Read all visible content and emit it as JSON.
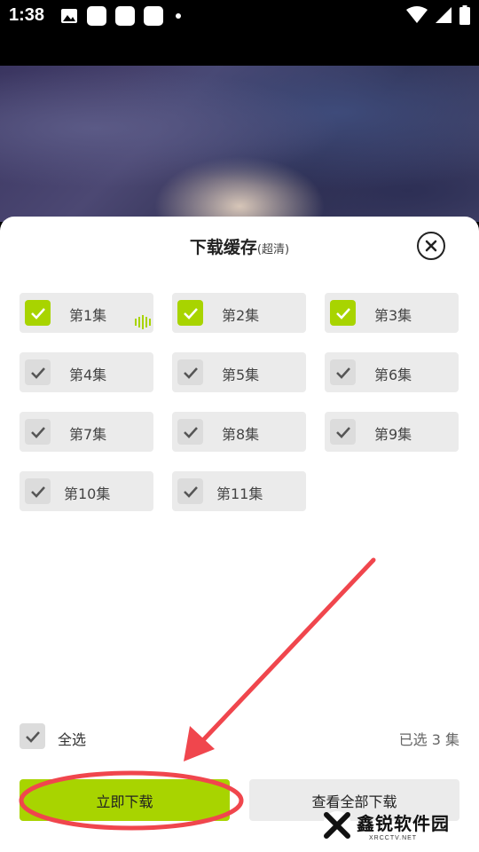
{
  "status_bar": {
    "time": "1:38",
    "icons_left": [
      "image-icon",
      "app-icon",
      "app-icon",
      "app-icon",
      "dot-icon"
    ],
    "icons_right": [
      "wifi-icon",
      "signal-icon",
      "battery-icon"
    ]
  },
  "sheet": {
    "title": "下载缓存",
    "quality": "(超清)",
    "episodes": [
      {
        "label": "第1集",
        "checked": true,
        "playing": true
      },
      {
        "label": "第2集",
        "checked": true,
        "playing": false
      },
      {
        "label": "第3集",
        "checked": true,
        "playing": false
      },
      {
        "label": "第4集",
        "checked": false,
        "playing": false
      },
      {
        "label": "第5集",
        "checked": false,
        "playing": false
      },
      {
        "label": "第6集",
        "checked": false,
        "playing": false
      },
      {
        "label": "第7集",
        "checked": false,
        "playing": false
      },
      {
        "label": "第8集",
        "checked": false,
        "playing": false
      },
      {
        "label": "第9集",
        "checked": false,
        "playing": false
      },
      {
        "label": "第10集",
        "checked": false,
        "playing": false
      },
      {
        "label": "第11集",
        "checked": false,
        "playing": false
      }
    ],
    "select_all_label": "全选",
    "selected_count": "已选 3 集",
    "download_button": "立即下载",
    "view_all_button": "查看全部下载"
  },
  "watermark": {
    "name_cn": "鑫锐软件园",
    "name_en": "XRCCTV.NET"
  },
  "colors": {
    "accent": "#a8d400",
    "annotation": "#f0464d"
  }
}
